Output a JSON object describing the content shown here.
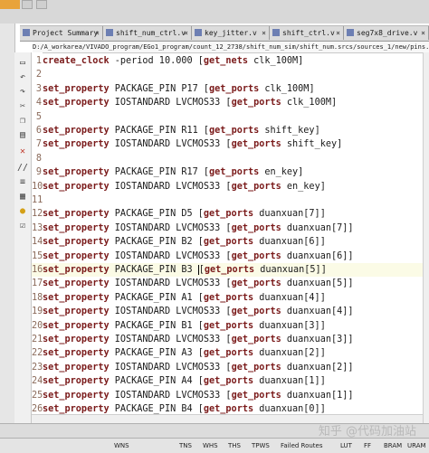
{
  "tabs": [
    {
      "label": "Project Summary",
      "active": false
    },
    {
      "label": "shift_num_ctrl.v",
      "active": false
    },
    {
      "label": "key_jitter.v",
      "active": false
    },
    {
      "label": "shift_ctrl.v",
      "active": false
    },
    {
      "label": "seg7x8_drive.v",
      "active": false
    }
  ],
  "file_path": "D:/A_workarea/VIVADO_program/EGo1_program/count_12_2738/shift_num_sim/shift_num.srcs/sources_1/new/pins.xdc",
  "code_lines": [
    {
      "n": "1",
      "cmd": "create_clock",
      "rest": " -period 10.000 ",
      "br1": "[",
      "kw": "get_nets",
      "arg": " clk_100M",
      "br2": "]"
    },
    {
      "n": "2",
      "cmd": "",
      "rest": "",
      "br1": "",
      "kw": "",
      "arg": "",
      "br2": ""
    },
    {
      "n": "3",
      "cmd": "set_property",
      "rest": " PACKAGE_PIN P17 ",
      "br1": "[",
      "kw": "get_ports",
      "arg": " clk_100M",
      "br2": "]"
    },
    {
      "n": "4",
      "cmd": "set_property",
      "rest": " IOSTANDARD LVCMOS33 ",
      "br1": "[",
      "kw": "get_ports",
      "arg": " clk_100M",
      "br2": "]"
    },
    {
      "n": "5",
      "cmd": "",
      "rest": "",
      "br1": "",
      "kw": "",
      "arg": "",
      "br2": ""
    },
    {
      "n": "6",
      "cmd": "set_property",
      "rest": " PACKAGE_PIN R11 ",
      "br1": "[",
      "kw": "get_ports",
      "arg": " shift_key",
      "br2": "]"
    },
    {
      "n": "7",
      "cmd": "set_property",
      "rest": " IOSTANDARD LVCMOS33 ",
      "br1": "[",
      "kw": "get_ports",
      "arg": " shift_key",
      "br2": "]"
    },
    {
      "n": "8",
      "cmd": "",
      "rest": "",
      "br1": "",
      "kw": "",
      "arg": "",
      "br2": ""
    },
    {
      "n": "9",
      "cmd": "set_property",
      "rest": " PACKAGE_PIN R17 ",
      "br1": "[",
      "kw": "get_ports",
      "arg": " en_key",
      "br2": "]"
    },
    {
      "n": "10",
      "cmd": "set_property",
      "rest": " IOSTANDARD LVCMOS33 ",
      "br1": "[",
      "kw": "get_ports",
      "arg": " en_key",
      "br2": "]"
    },
    {
      "n": "11",
      "cmd": "",
      "rest": "",
      "br1": "",
      "kw": "",
      "arg": "",
      "br2": ""
    },
    {
      "n": "12",
      "cmd": "set_property",
      "rest": " PACKAGE_PIN D5 ",
      "br1": "[",
      "kw": "get_ports",
      "arg": " duanxuan[7]",
      "br2": "]"
    },
    {
      "n": "13",
      "cmd": "set_property",
      "rest": " IOSTANDARD LVCMOS33 ",
      "br1": "[",
      "kw": "get_ports",
      "arg": " duanxuan[7]",
      "br2": "]"
    },
    {
      "n": "14",
      "cmd": "set_property",
      "rest": " PACKAGE_PIN B2 ",
      "br1": "[",
      "kw": "get_ports",
      "arg": " duanxuan[6]",
      "br2": "]"
    },
    {
      "n": "15",
      "cmd": "set_property",
      "rest": " IOSTANDARD LVCMOS33 ",
      "br1": "[",
      "kw": "get_ports",
      "arg": " duanxuan[6]",
      "br2": "]"
    },
    {
      "n": "16",
      "cmd": "set_property",
      "rest": " PACKAGE_PIN B3 ",
      "br1": "[",
      "kw": "get_ports",
      "arg": " duanxuan[5]",
      "br2": "]"
    },
    {
      "n": "17",
      "cmd": "set_property",
      "rest": " IOSTANDARD LVCMOS33 ",
      "br1": "[",
      "kw": "get_ports",
      "arg": " duanxuan[5]",
      "br2": "]"
    },
    {
      "n": "18",
      "cmd": "set_property",
      "rest": " PACKAGE_PIN A1 ",
      "br1": "[",
      "kw": "get_ports",
      "arg": " duanxuan[4]",
      "br2": "]"
    },
    {
      "n": "19",
      "cmd": "set_property",
      "rest": " IOSTANDARD LVCMOS33 ",
      "br1": "[",
      "kw": "get_ports",
      "arg": " duanxuan[4]",
      "br2": "]"
    },
    {
      "n": "20",
      "cmd": "set_property",
      "rest": " PACKAGE_PIN B1 ",
      "br1": "[",
      "kw": "get_ports",
      "arg": " duanxuan[3]",
      "br2": "]"
    },
    {
      "n": "21",
      "cmd": "set_property",
      "rest": " IOSTANDARD LVCMOS33 ",
      "br1": "[",
      "kw": "get_ports",
      "arg": " duanxuan[3]",
      "br2": "]"
    },
    {
      "n": "22",
      "cmd": "set_property",
      "rest": " PACKAGE_PIN A3 ",
      "br1": "[",
      "kw": "get_ports",
      "arg": " duanxuan[2]",
      "br2": "]"
    },
    {
      "n": "23",
      "cmd": "set_property",
      "rest": " IOSTANDARD LVCMOS33 ",
      "br1": "[",
      "kw": "get_ports",
      "arg": " duanxuan[2]",
      "br2": "]"
    },
    {
      "n": "24",
      "cmd": "set_property",
      "rest": " PACKAGE_PIN A4 ",
      "br1": "[",
      "kw": "get_ports",
      "arg": " duanxuan[1]",
      "br2": "]"
    },
    {
      "n": "25",
      "cmd": "set_property",
      "rest": " IOSTANDARD LVCMOS33 ",
      "br1": "[",
      "kw": "get_ports",
      "arg": " duanxuan[1]",
      "br2": "]"
    },
    {
      "n": "26",
      "cmd": "set_property",
      "rest": " PACKAGE_PIN B4 ",
      "br1": "[",
      "kw": "get_ports",
      "arg": " duanxuan[0]",
      "br2": "]"
    }
  ],
  "status_bar": {
    "wns": "WNS",
    "tns": "TNS",
    "whs": "WHS",
    "ths": "THS",
    "tpws": "TPWS",
    "failed_routes": "Failed Routes",
    "lut": "LUT",
    "ff": "FF",
    "bram": "BRAM",
    "uram": "URAM"
  },
  "watermark": "知乎 @代码加油站",
  "icons": [
    "file-icon",
    "undo-icon",
    "redo-icon",
    "cut-icon",
    "copy-icon",
    "paste-icon",
    "delete-icon",
    "comment-icon",
    "indent-icon",
    "template-icon",
    "bulb-icon",
    "checklist-icon"
  ]
}
